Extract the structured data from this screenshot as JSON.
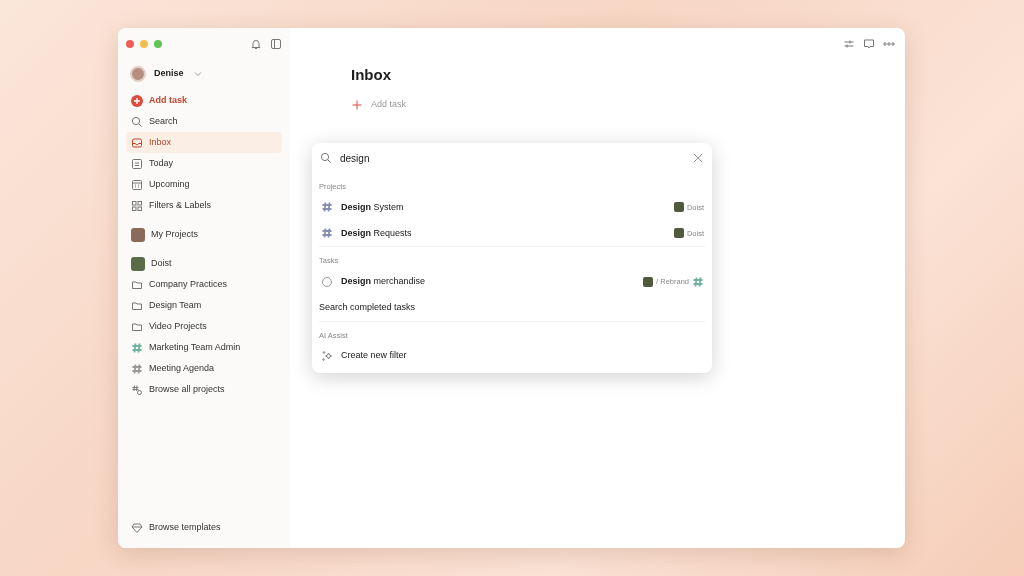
{
  "window": {
    "controls": [
      {
        "color": "#ec5f57"
      },
      {
        "color": "#f4bd4f"
      },
      {
        "color": "#61c454"
      }
    ]
  },
  "sidebar": {
    "user": "Denise",
    "add_task": "Add task",
    "nav": [
      {
        "kind": "search",
        "label": "Search",
        "selected": false
      },
      {
        "kind": "inbox",
        "label": "Inbox",
        "selected": true
      },
      {
        "kind": "today",
        "label": "Today",
        "selected": false
      },
      {
        "kind": "upcoming",
        "label": "Upcoming",
        "selected": false
      },
      {
        "kind": "filters",
        "label": "Filters & Labels",
        "selected": false
      }
    ],
    "my_projects": "My Projects",
    "projects": [
      {
        "kind": "workspace",
        "label": "Doist"
      },
      {
        "kind": "folder",
        "label": "Company Practices"
      },
      {
        "kind": "folder",
        "label": "Design Team"
      },
      {
        "kind": "folder",
        "label": "Video Projects"
      },
      {
        "kind": "hash",
        "label": "Marketing Team Admin",
        "color": "#6fb3a0"
      },
      {
        "kind": "hash",
        "label": "Meeting Agenda",
        "color": "#999999"
      },
      {
        "kind": "browse",
        "label": "Browse all projects"
      }
    ],
    "footer": "Browse templates"
  },
  "main": {
    "title": "Inbox",
    "add_task": "Add task"
  },
  "search": {
    "value": "design",
    "sections": [
      {
        "heading": "Projects",
        "items": [
          {
            "kind": "project",
            "title": "**Design** System",
            "meta": "Doist"
          },
          {
            "kind": "project",
            "title": "**Design** Requests",
            "meta": "Doist"
          }
        ]
      },
      {
        "heading": "Tasks",
        "items": [
          {
            "kind": "task",
            "title": "**Design** merchandise",
            "meta": "/ Rebrand"
          },
          {
            "kind": "action",
            "title": "Search completed tasks"
          }
        ]
      },
      {
        "heading": "AI Assist",
        "items": [
          {
            "kind": "ai",
            "title": "Create new filter"
          }
        ]
      }
    ]
  }
}
